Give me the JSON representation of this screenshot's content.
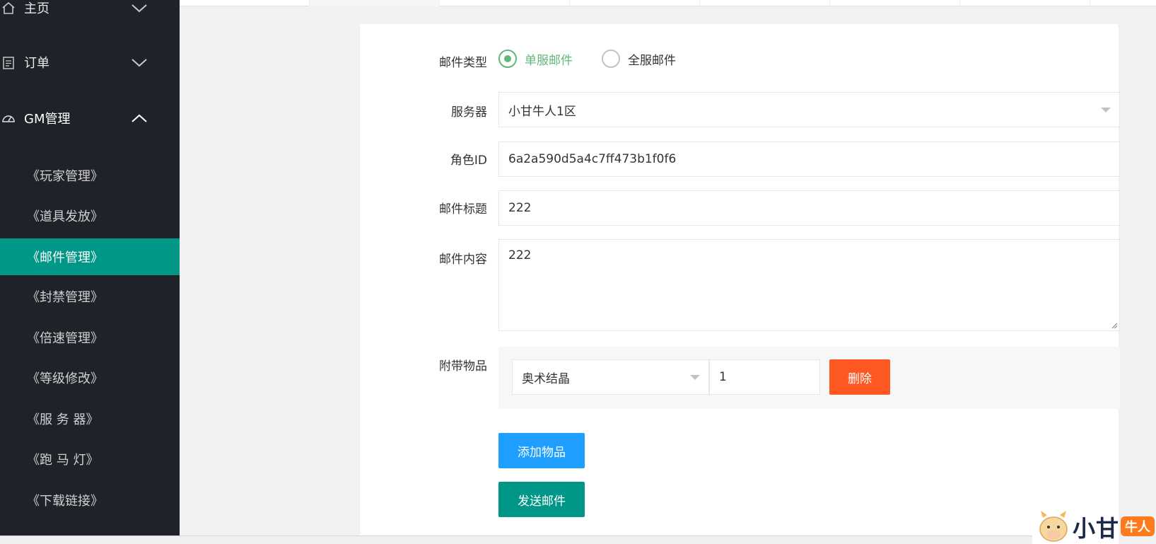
{
  "sidebar": {
    "top_items": [
      {
        "label": "主页",
        "icon": "home-icon",
        "expanded": false
      },
      {
        "label": "订单",
        "icon": "clipboard-icon",
        "expanded": false
      },
      {
        "label": "GM管理",
        "icon": "gauge-icon",
        "expanded": true
      }
    ],
    "sub_items": [
      {
        "label": "《玩家管理》",
        "active": false
      },
      {
        "label": "《道具发放》",
        "active": false
      },
      {
        "label": "《邮件管理》",
        "active": true
      },
      {
        "label": "《封禁管理》",
        "active": false
      },
      {
        "label": "《倍速管理》",
        "active": false
      },
      {
        "label": "《等级修改》",
        "active": false
      },
      {
        "label": "《服 务 器》",
        "active": false
      },
      {
        "label": "《跑 马 灯》",
        "active": false
      },
      {
        "label": "《下载链接》",
        "active": false
      }
    ]
  },
  "form": {
    "mail_type_label": "邮件类型",
    "mail_type_options": [
      "单服邮件",
      "全服邮件"
    ],
    "mail_type_selected": "单服邮件",
    "server_label": "服务器",
    "server_value": "小甘牛人1区",
    "role_id_label": "角色ID",
    "role_id_value": "6a2a590d5a4c7ff473b1f0f6",
    "title_label": "邮件标题",
    "title_value": "222",
    "content_label": "邮件内容",
    "content_value": "222",
    "attach_label": "附带物品",
    "attach_item": "奥术结晶",
    "attach_qty": "1",
    "delete_label": "删除",
    "add_item_label": "添加物品",
    "send_label": "发送邮件"
  },
  "watermark": {
    "text": "小甘",
    "badge": "牛人"
  },
  "colors": {
    "sidebar_bg": "#20222a",
    "active": "#009688",
    "radio_on": "#5fb878",
    "delete": "#ff5722",
    "add": "#1e9fff",
    "send": "#009688"
  }
}
